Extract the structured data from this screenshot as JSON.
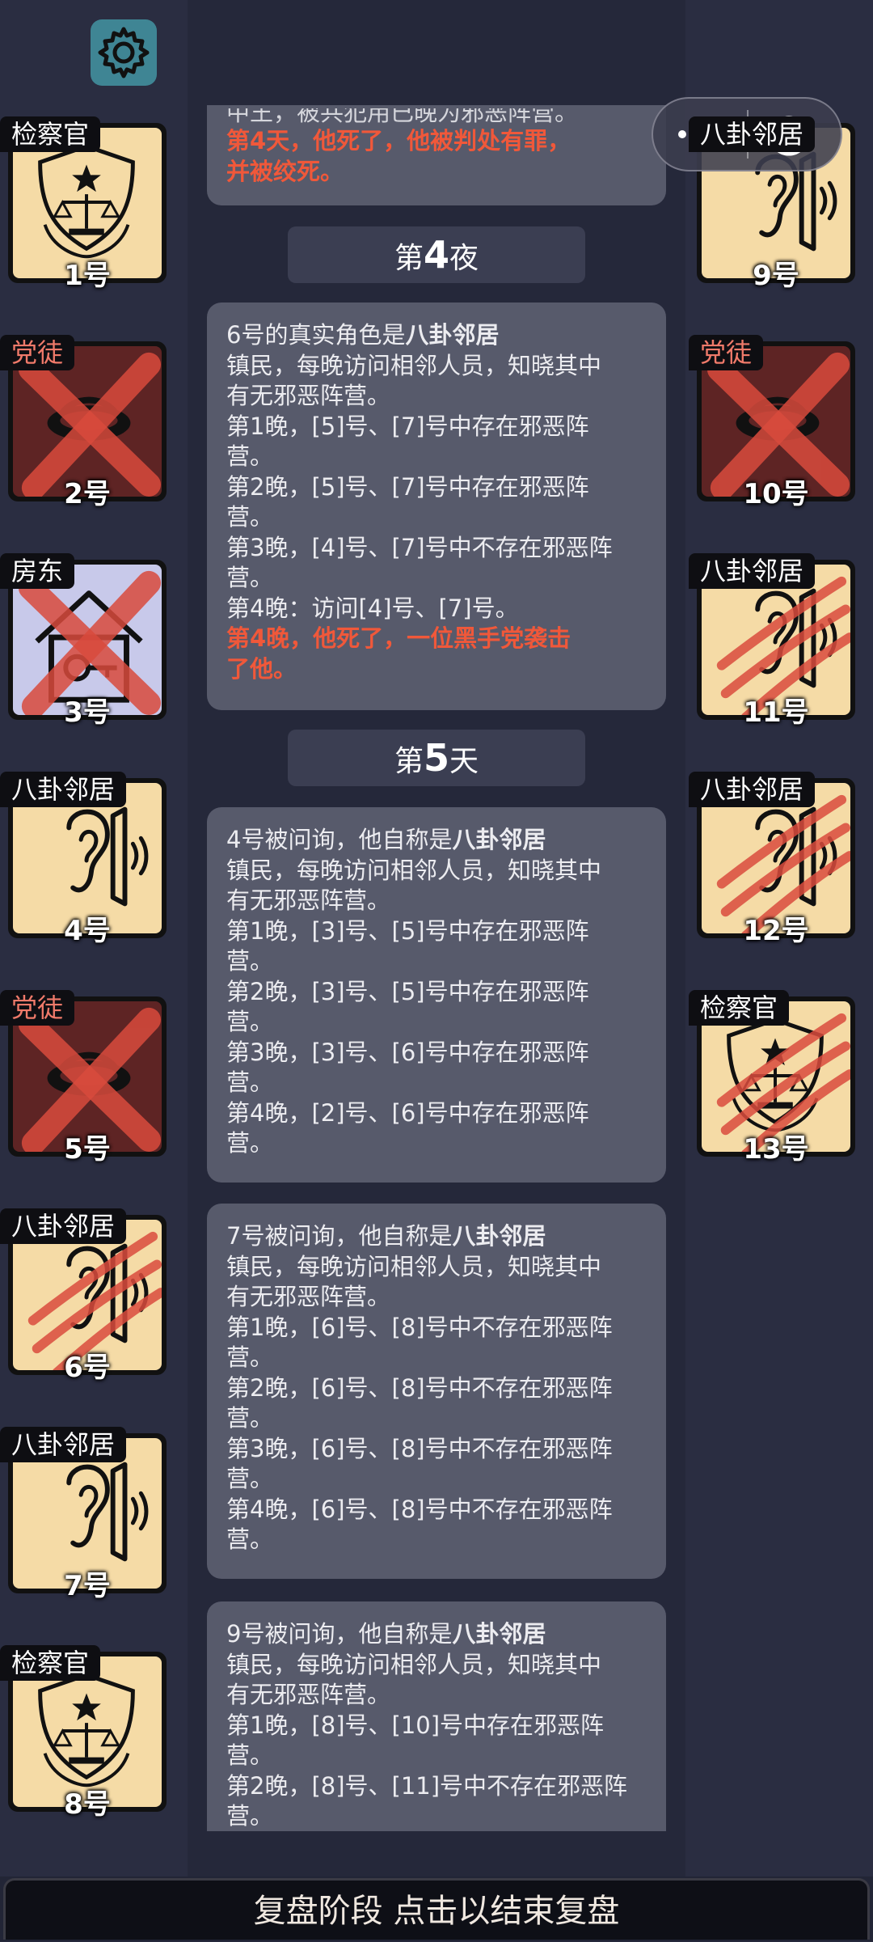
{
  "header": {
    "settings_icon": "gear-icon",
    "capsule_menu_icon": "more-dots-icon",
    "capsule_close_icon": "close-target-icon"
  },
  "colors": {
    "accent_red": "#f0583a",
    "card_bg": "#f5dba6",
    "evil_bg": "#5e2424",
    "landlord_bg": "#c8c9ea",
    "settings_bg": "#3f8594"
  },
  "players_left": [
    {
      "role": "检察官",
      "number": "1号",
      "icon": "prosecutor-badge-icon",
      "state": "alive",
      "evil": false
    },
    {
      "role": "党徒",
      "number": "2号",
      "icon": "cultist-icon",
      "state": "dead-x",
      "evil": true
    },
    {
      "role": "房东",
      "number": "3号",
      "icon": "house-key-icon",
      "state": "dead-x",
      "evil": false
    },
    {
      "role": "八卦邻居",
      "number": "4号",
      "icon": "ear-icon",
      "state": "alive",
      "evil": false
    },
    {
      "role": "党徒",
      "number": "5号",
      "icon": "cultist-icon",
      "state": "dead-x",
      "evil": true
    },
    {
      "role": "八卦邻居",
      "number": "6号",
      "icon": "ear-icon",
      "state": "clawed",
      "evil": false
    },
    {
      "role": "八卦邻居",
      "number": "7号",
      "icon": "ear-icon",
      "state": "alive",
      "evil": false
    },
    {
      "role": "检察官",
      "number": "8号",
      "icon": "prosecutor-badge-icon",
      "state": "alive",
      "evil": false
    }
  ],
  "players_right": [
    {
      "role": "八卦邻居",
      "number": "9号",
      "icon": "ear-icon",
      "state": "alive",
      "evil": false
    },
    {
      "role": "党徒",
      "number": "10号",
      "icon": "cultist-icon",
      "state": "dead-x",
      "evil": true
    },
    {
      "role": "八卦邻居",
      "number": "11号",
      "icon": "ear-icon",
      "state": "clawed",
      "evil": false
    },
    {
      "role": "八卦邻居",
      "number": "12号",
      "icon": "ear-icon",
      "state": "clawed",
      "evil": false
    },
    {
      "role": "检察官",
      "number": "13号",
      "icon": "prosecutor-badge-icon",
      "state": "clawed",
      "evil": false
    }
  ],
  "log": {
    "msg0": {
      "line_top": "中王，被共犯用已晚为邪恶阵营。",
      "death_line1": "第4天，他死了，他被判处有罪，",
      "death_line2": "并被绞死。"
    },
    "night4": {
      "prefix": "第",
      "num": "4",
      "suffix": "夜"
    },
    "msg1": {
      "intro_pre": "6号的真实角色是",
      "intro_role": "八卦邻居",
      "desc1": "镇民，每晚访问相邻人员，知晓其中",
      "desc2": "有无邪恶阵营。",
      "l1a": "第1晚，[5]号、[7]号中存在邪恶阵",
      "l1b": "营。",
      "l2a": "第2晚，[5]号、[7]号中存在邪恶阵",
      "l2b": "营。",
      "l3a": "第3晚，[4]号、[7]号中不存在邪恶阵",
      "l3b": "营。",
      "l4": "第4晚：访问[4]号、[7]号。",
      "death1": "第4晚，他死了，一位黑手党袭击",
      "death2": "了他。"
    },
    "day5": {
      "prefix": "第",
      "num": "5",
      "suffix": "天"
    },
    "msg2": {
      "intro_pre": "4号被问询，他自称是",
      "intro_role": "八卦邻居",
      "desc1": "镇民，每晚访问相邻人员，知晓其中",
      "desc2": "有无邪恶阵营。",
      "l1a": "第1晚，[3]号、[5]号中存在邪恶阵",
      "l1b": "营。",
      "l2a": "第2晚，[3]号、[5]号中存在邪恶阵",
      "l2b": "营。",
      "l3a": "第3晚，[3]号、[6]号中存在邪恶阵",
      "l3b": "营。",
      "l4a": "第4晚，[2]号、[6]号中存在邪恶阵",
      "l4b": "营。"
    },
    "msg3": {
      "intro_pre": "7号被问询，他自称是",
      "intro_role": "八卦邻居",
      "desc1": "镇民，每晚访问相邻人员，知晓其中",
      "desc2": "有无邪恶阵营。",
      "l1a": "第1晚，[6]号、[8]号中不存在邪恶阵",
      "l1b": "营。",
      "l2a": "第2晚，[6]号、[8]号中不存在邪恶阵",
      "l2b": "营。",
      "l3a": "第3晚，[6]号、[8]号中不存在邪恶阵",
      "l3b": "营。",
      "l4a": "第4晚，[6]号、[8]号中不存在邪恶阵",
      "l4b": "营。"
    },
    "msg4": {
      "intro_pre": "9号被问询，他自称是",
      "intro_role": "八卦邻居",
      "desc1": "镇民，每晚访问相邻人员，知晓其中",
      "desc2": "有无邪恶阵营。",
      "l1a": "第1晚，[8]号、[10]号中存在邪恶阵",
      "l1b": "营。",
      "l2a": "第2晚，[8]号、[11]号中不存在邪恶阵",
      "l2b": "营。"
    }
  },
  "footer": {
    "button_label": "复盘阶段 点击以结束复盘"
  }
}
